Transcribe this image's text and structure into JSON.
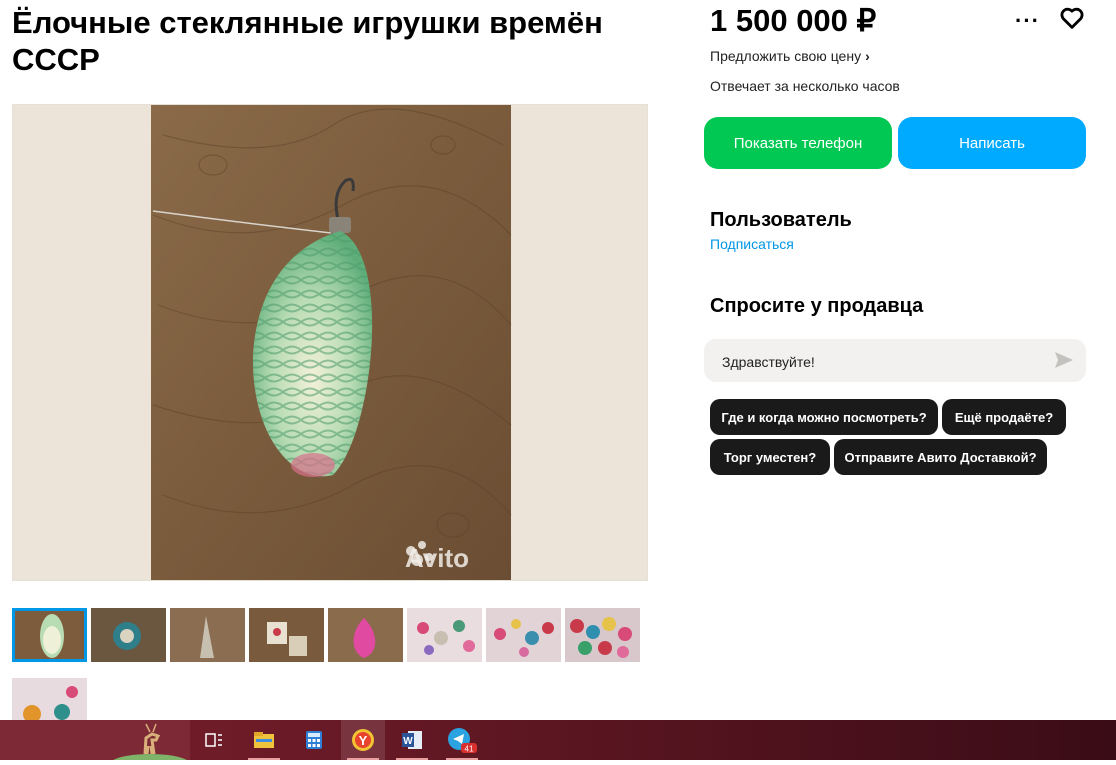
{
  "listing": {
    "title": "Ёлочные стеклянные игрушки времён СССР",
    "price": "1 500 000 ₽",
    "offer_link": "Предложить свою цену",
    "reply_time": "Отвечает за несколько часов"
  },
  "actions": {
    "show_phone": "Показать телефон",
    "write": "Написать",
    "more_icon": "more-dots-icon",
    "favorite_icon": "heart-icon"
  },
  "seller": {
    "name": "Пользователь",
    "subscribe": "Подписаться"
  },
  "ask": {
    "heading": "Спросите у продавца",
    "message_value": "Здравствуйте!",
    "send_icon": "send-icon",
    "chips": [
      "Где и когда можно посмотреть?",
      "Ещё продаёте?",
      "Торг уместен?",
      "Отправите Авито Доставкой?"
    ]
  },
  "gallery": {
    "watermark": "Avito",
    "thumbnail_count": 9,
    "active_thumbnail": 1
  },
  "taskbar": {
    "telegram_badge": "41",
    "icons": [
      "task-view-icon",
      "file-explorer-icon",
      "calculator-icon",
      "yandex-browser-icon",
      "word-icon",
      "telegram-icon"
    ]
  },
  "colors": {
    "green": "#00c853",
    "blue": "#00aaff",
    "link": "#0097e6",
    "chip": "#1a1a1a"
  }
}
